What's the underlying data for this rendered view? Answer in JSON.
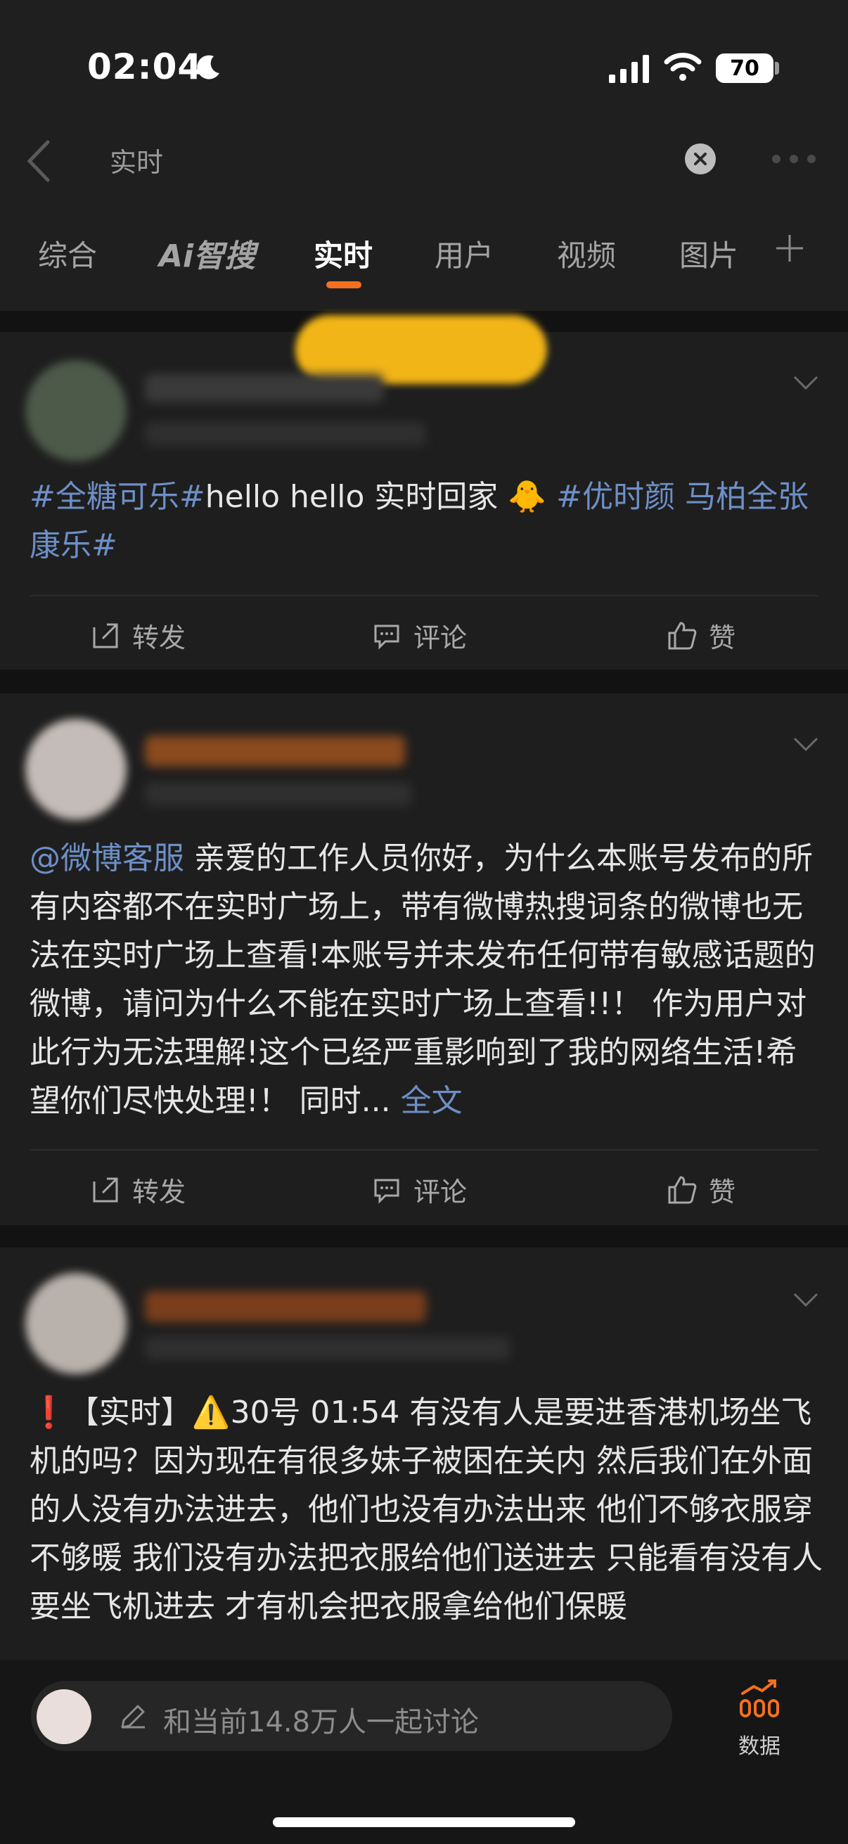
{
  "status_bar": {
    "time": "02:04",
    "battery": "70"
  },
  "search": {
    "query": "实时"
  },
  "tabs": [
    {
      "label": "综合"
    },
    {
      "label": "Ai智搜"
    },
    {
      "label": "实时"
    },
    {
      "label": "用户"
    },
    {
      "label": "视频"
    },
    {
      "label": "图片"
    }
  ],
  "posts": [
    {
      "tag1": "#全糖可乐#",
      "text1": "hello hello 实时回家",
      "emoji": "🐥",
      "tag2": "#优时颜 马柏全张康乐#"
    },
    {
      "mention": "@微博客服",
      "text": " 亲爱的工作人员你好，为什么本账号发布的所有内容都不在实时广场上，带有微博热搜词条的微博也无法在实时广场上查看!本账号并未发布任何带有敏感话题的微博，请问为什么不能在实时广场上查看!!！ 作为用户对此行为无法理解!这个已经严重影响到了我的网络生活!希望你们尽快处理!！ 同时...",
      "more": " 全文"
    },
    {
      "text": "❗【实时】⚠️30号 01:54 有没有人是要进香港机场坐飞机的吗？因为现在有很多妹子被困在关内 然后我们在外面的人没有办法进去，他们也没有办法出来 他们不够衣服穿不够暖 我们没有办法把衣服给他们送进去 只能看有没有人要坐飞机进去 才有机会把衣服拿给他们保暖"
    }
  ],
  "actions": {
    "repost": "转发",
    "comment": "评论",
    "like": "赞"
  },
  "bottom": {
    "placeholder": "和当前14.8万人一起讨论",
    "data_label": "数据"
  }
}
